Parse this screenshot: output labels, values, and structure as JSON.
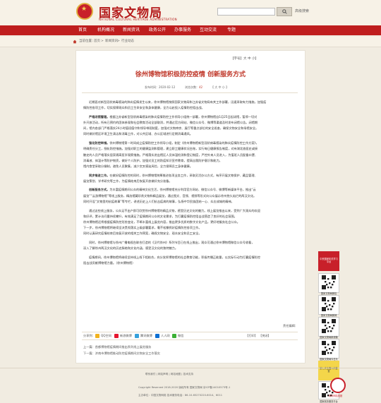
{
  "header": {
    "site_name": "国家文物局",
    "site_name_en": "NATIONAL CULTURAL HERITAGE ADMINISTRATION",
    "search_button": "搜索",
    "advanced_search": "高级搜索"
  },
  "nav": [
    "首页",
    "机构概况",
    "新闻资讯",
    "政务公开",
    "办事服务",
    "互动交流",
    "专题"
  ],
  "breadcrumb": [
    "当前位置：",
    "首页",
    "新闻资讯",
    "行业动态"
  ],
  "font_size": {
    "label": "【字号】",
    "big": "大",
    "medium": "中",
    "small": "小",
    "close": "】"
  },
  "article": {
    "title": "徐州博物馆积极防控疫情 创新服务方式",
    "publish_date": "发布时间：2020-02-12",
    "views_label": "浏览次数：",
    "views_value": "42",
    "size_label": "【 大 中 小 】",
    "paragraphs": [
      {
        "lines": [
          "近期面对新型冠状病毒感染的肺炎疫情发生以来，徐州博物馆按照国家文物局和江苏省文物局有关工作部署，迅速采取有力措施，加强疫",
          "情防控各项工作，切实保障观众和员工生命安全和身体健康，全力以赴投入疫情防控阻击战。"
        ]
      },
      {
        "lead": "严格闭馆管理。",
        "lines": [
          "根据江苏省新型冠状病毒感染的肺炎疫情防控工作领导小组统一部署，徐州博物馆自1月25日起闭馆，暂停一切对",
          "外开放活动，所有已预约的团体参观和社会教育活动全部取消，并通过官方网站、微信公众号、微博等渠道及时发布闭馆公告。闭馆期",
          "间，馆内各部门严格落实24小时值班值守和领导带班制度，加强对文物库房、展厅等重点部位的安全巡查，确保文物安全和场馆安全。",
          "同时做好馆区环境卫生清洁和消毒工作，对公共区域、办公区域进行定期消毒通风。"
        ]
      },
      {
        "lead": "强化防控举措。",
        "lines": [
          "徐州博物馆第一时间成立疫情防控工作领导小组，制定《徐州博物馆新型冠状病毒感染的肺炎疫情防控工作方案》，",
          "明确责任分工，细化防控措施。加强对职工的健康监测和管理，建立职工健康状况台账，实行每日健康报告制度，对有湖北旅居史或接",
          "触史的人员严格落实居家隔离医学观察措施。严格落实进出馆区人员体温检测和登记制度，严控外来人员进入，为值班人员配备口罩、",
          "消毒液、体温计等防护物资，做好个人防护。加强对员工的防疫知识宣传教育，提高自我防护意识和能力。",
          "馆内食堂采取分餐制，避免人员聚集，减少交叉感染风险，全力保障员工身体健康。"
        ]
      },
      {
        "lead": "同步推进工作。",
        "lines": [
          "在做好疫情防控的同时，徐州博物馆统筹推进各项业务工作，采取灵活办公方式，有序开展文物保护、藏品管理、",
          "展览策划、学术研究等工作，为疫情结束后恢复开放做好充分准备。"
        ]
      },
      {
        "lead": "创新服务方式。",
        "lines": [
          "为丰富疫情期间公众的精神文化生活，徐州博物馆充分利用官方网站、微信公众号、微博等新媒体平台，推出“云",
          "展览”“云游博物馆”等线上服务，精选馆藏珍贵文物和精品展览，通过图文、音频、视频等形式向公众展示徐州悠久灿烂的两汉文化。",
          "同时开设“文物里的抗疫故事”等专栏，讲述历史上人们抗击疫病的故事，弘扬中华民族团结一心、众志成城的精神。"
        ]
      },
      {
        "lines": [
          "通过这些线上服务，公众足不出户即可欣赏徐州博物馆的精品文物，感受历史文化的魅力。线上展览推出以来，受到广大观众的欢迎",
          "和好评，累计访问量持续攀升，有效满足了疫情期间公众的文化需求，为打赢疫情防控阻击战营造了良好的社会氛围。",
          "徐州博物馆还将根据疫情防控形势变化，不断丰富线上展览内容，推出更多优质的数字文化产品，更好地服务社会公众。",
          "下一步，徐州博物馆将继续坚决贯彻落实上级部署要求，毫不松懈抓好疫情防控各项工作。",
          "同时认真研究疫情结束后恢复开放的相关工作预案，确保文物安全、观众安全和员工安全。"
        ]
      },
      {
        "lines": [
          "同时，徐州博物馆与徐州广播电视台联合打造的《汉代徐州》系列节目已在线上推出，观众可通过徐州博物馆微信公众号收看，",
          "深入了解徐州两汉文化的历史脉络和文化内涵，感受汉文化的独特魅力。"
        ]
      },
      {
        "lines": [
          "疫情期间，徐州博物馆将继续坚持线上线下相结合，充分发挥博物馆的社会教育功能，积极传播正能量，以实际行动为打赢疫情防控",
          "阻击战贡献博物馆力量。（徐州博物馆）"
        ]
      }
    ],
    "editor": "责任编辑：",
    "share_label": "分享到：",
    "share": [
      "QQ空间",
      "新浪微博",
      "腾讯微博",
      "人人网",
      "微信"
    ],
    "tools": [
      "【打印】",
      "【关闭】"
    ],
    "prev": "上一篇：首都博物馆疫情期间推出系列线上展览服务",
    "next": "下一篇：济南市博物馆推动防控疫情期间文物安全工作落实"
  },
  "sidebar_ads": [
    {
      "label": "中央国家机关学习平台",
      "color": "#c8202a"
    },
    {
      "label": "国家文物局微信",
      "color": "#ffffff"
    },
    {
      "label": "国家文物局微博",
      "color": "#ffffff"
    },
    {
      "label": "国家文物局新浪微博",
      "color": "#ffffff"
    },
    {
      "label": "国家文物局今日头条",
      "color": "#ffffff"
    },
    {
      "label": "第七次全国人口普查",
      "color": "#f4d64a"
    },
    {
      "label": "国家政务服务平台",
      "color": "#ffffff"
    }
  ],
  "footer": {
    "links": "联系我们 | 网站声明 | 网站地图 | 技术支持",
    "copyright": "Copyright Reserved 2018-2020 版权所有 国家文物局 京ICP备14010573号-1",
    "sponsor": "主办单位：中国文物网络  技术服务电话：86-10-65270220-6014、6011",
    "badge": "政府网站找错"
  }
}
